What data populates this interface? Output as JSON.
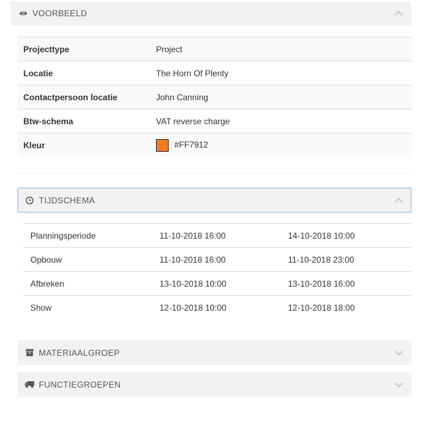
{
  "preview": {
    "title": "VOORBEELD",
    "icon": "eye-icon",
    "rows": [
      {
        "label": "Projecttype",
        "value": "Project"
      },
      {
        "label": "Locatie",
        "value": "The Horn Of Plenty"
      },
      {
        "label": "Contactpersoon locatie",
        "value": "John Canning"
      },
      {
        "label": "Btw-schema",
        "value": "VAT reverse charge"
      },
      {
        "label": "Kleur",
        "value": "#FF7912"
      }
    ],
    "color_swatch": "#F47B20"
  },
  "schedule": {
    "title": "TIJDSCHEMA",
    "icon": "clock-icon",
    "rows": [
      {
        "name": "Planningsperiode",
        "start": "11-10-2018 16:00",
        "end": "14-10-2018 10:00"
      },
      {
        "name": "Opbouw",
        "start": "11-10-2018 16:00",
        "end": "11-10-2018 23:00"
      },
      {
        "name": "Afbreken",
        "start": "13-10-2018 10:00",
        "end": "13-10-2018 16:00"
      },
      {
        "name": "Show",
        "start": "12-10-2018 10:00",
        "end": "12-10-2018 18:00"
      }
    ]
  },
  "material": {
    "title": "MATERIAALGROEP",
    "icon": "archive-icon"
  },
  "functions": {
    "title": "FUNCTIEGROEPEN",
    "icon": "truck-icon"
  }
}
